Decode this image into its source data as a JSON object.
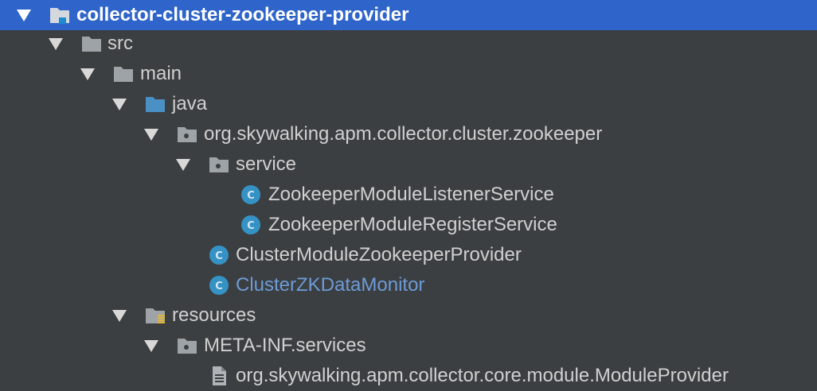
{
  "tree": {
    "root": {
      "label": "collector-cluster-zookeeper-provider",
      "icon": "module-folder-icon"
    },
    "nodes": [
      {
        "label": "src",
        "icon": "folder-icon"
      },
      {
        "label": "main",
        "icon": "folder-icon"
      },
      {
        "label": "java",
        "icon": "source-folder-icon"
      },
      {
        "label": "org.skywalking.apm.collector.cluster.zookeeper",
        "icon": "package-icon"
      },
      {
        "label": "service",
        "icon": "package-icon"
      },
      {
        "label": "ZookeeperModuleListenerService",
        "icon": "class-icon"
      },
      {
        "label": "ZookeeperModuleRegisterService",
        "icon": "class-icon"
      },
      {
        "label": "ClusterModuleZookeeperProvider",
        "icon": "class-icon"
      },
      {
        "label": "ClusterZKDataMonitor",
        "icon": "class-icon"
      },
      {
        "label": "resources",
        "icon": "resources-folder-icon"
      },
      {
        "label": "META-INF.services",
        "icon": "package-icon"
      },
      {
        "label": "org.skywalking.apm.collector.core.module.ModuleProvider",
        "icon": "file-icon"
      }
    ]
  },
  "colors": {
    "background": "#3c3f41",
    "selected_background": "#2f65ca",
    "text": "#d0d0d0",
    "selected_text": "#ffffff",
    "highlight_text": "#6d9bd6",
    "class_icon": "#3592c4",
    "source_folder_icon": "#4a90c5",
    "folder_icon": "#9ea3a8"
  }
}
